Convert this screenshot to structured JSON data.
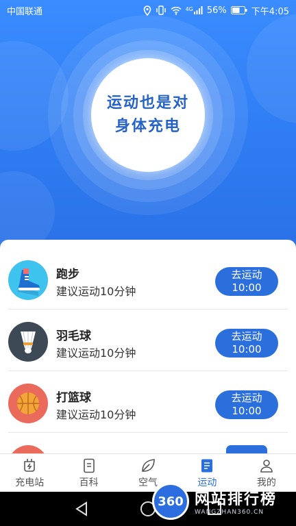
{
  "status_bar": {
    "carrier": "中国联通",
    "network": "4G",
    "battery": "56%",
    "time": "下午4:05"
  },
  "hero": {
    "slogan_line1": "运动也是对",
    "slogan_line2": "身体充电"
  },
  "sports": [
    {
      "name": "跑步",
      "hint": "建议运动10分钟",
      "button_line1": "去运动",
      "button_line2": "10:00",
      "icon": "running-shoe-icon",
      "color": "#3ec3ee"
    },
    {
      "name": "羽毛球",
      "hint": "建议运动10分钟",
      "button_line1": "去运动",
      "button_line2": "10:00",
      "icon": "shuttlecock-icon",
      "color": "#3d4a56"
    },
    {
      "name": "打篮球",
      "hint": "建议运动10分钟",
      "button_line1": "去运动",
      "button_line2": "10:00",
      "icon": "basketball-icon",
      "color": "#ea6b5c"
    }
  ],
  "tabs": [
    {
      "label": "充电站",
      "icon": "plug-icon"
    },
    {
      "label": "百科",
      "icon": "document-icon"
    },
    {
      "label": "空气",
      "icon": "leaf-icon"
    },
    {
      "label": "运动",
      "icon": "notebook-icon",
      "active": true
    },
    {
      "label": "我的",
      "icon": "person-icon"
    }
  ],
  "watermark": {
    "badge": "360",
    "title": "网站排行榜",
    "subtitle": "WANGZHAN360.CN"
  },
  "colors": {
    "primary": "#2b6fdd",
    "hero_blue": "#3a8cff"
  }
}
